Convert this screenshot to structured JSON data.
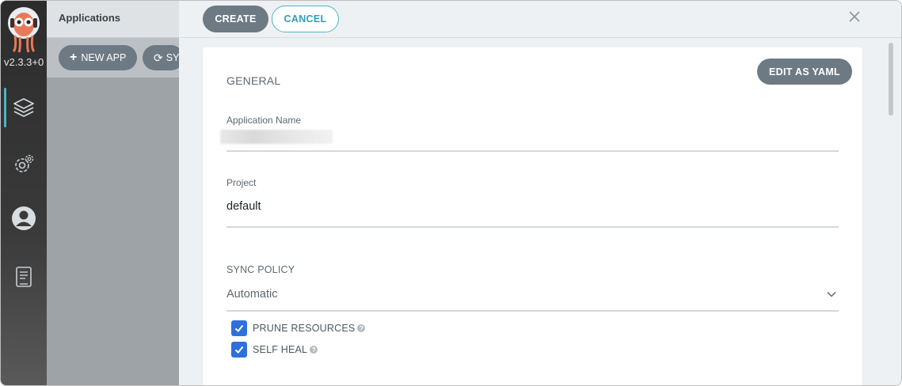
{
  "nav": {
    "version": "v2.3.3+0",
    "items": [
      {
        "name": "applications",
        "icon": "layers-icon",
        "active": true
      },
      {
        "name": "settings",
        "icon": "gear-icon",
        "active": false
      },
      {
        "name": "user-info",
        "icon": "user-icon",
        "active": false
      },
      {
        "name": "documentation",
        "icon": "book-icon",
        "active": false
      }
    ]
  },
  "apps": {
    "title": "Applications",
    "new_app_label": "NEW APP",
    "sync_label": "SY"
  },
  "panel": {
    "create_label": "CREATE",
    "cancel_label": "CANCEL",
    "edit_yaml_label": "EDIT AS YAML",
    "general_heading": "GENERAL",
    "app_name_label": "Application Name",
    "project_label": "Project",
    "project_value": "default",
    "sync_policy_heading": "SYNC POLICY",
    "sync_policy_value": "Automatic",
    "prune_label": "PRUNE RESOURCES",
    "prune_checked": true,
    "self_heal_label": "SELF HEAL",
    "self_heal_checked": true
  },
  "colors": {
    "accent": "#4cb4c6",
    "button": "#6d7a84",
    "checkbox": "#2f6fdc"
  }
}
